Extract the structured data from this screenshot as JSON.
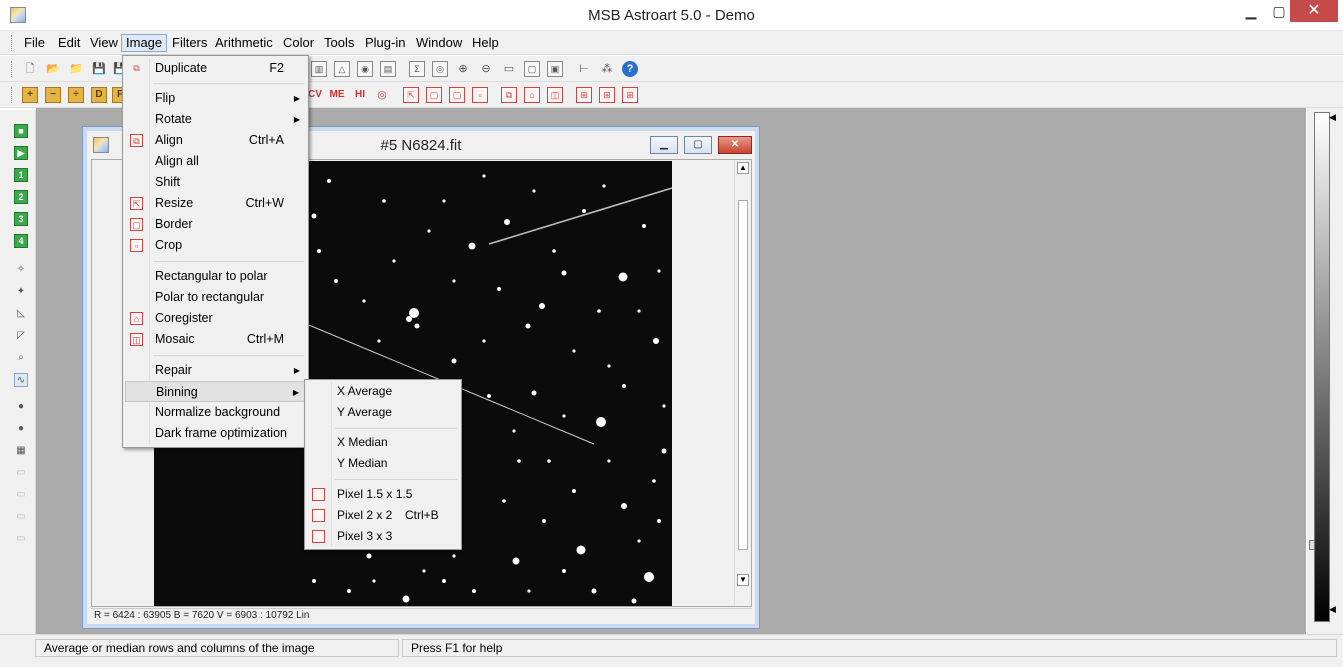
{
  "window": {
    "title": "MSB Astroart 5.0 - Demo",
    "min": "▁",
    "max": "▢",
    "close": "✕"
  },
  "menubar": [
    "File",
    "Edit",
    "View",
    "Image",
    "Filters",
    "Arithmetic",
    "Color",
    "Tools",
    "Plug-in",
    "Window",
    "Help"
  ],
  "toolbar2_text": [
    "CV",
    "ME",
    "HI"
  ],
  "child": {
    "title": "#5 N6824.fit",
    "status": "R = 6424 : 63905    B = 7620    V = 6903 : 10792 Lin"
  },
  "image_menu": {
    "items": [
      {
        "label": "Duplicate",
        "shortcut": "F2",
        "icon": "duplicate-icon"
      },
      {
        "label": "Flip",
        "submenu": "▶"
      },
      {
        "label": "Rotate",
        "submenu": "▶"
      },
      {
        "label": "Align",
        "shortcut": "Ctrl+A",
        "icon": "align-icon"
      },
      {
        "label": "Align all"
      },
      {
        "label": "Shift"
      },
      {
        "label": "Resize",
        "shortcut": "Ctrl+W",
        "icon": "resize-icon"
      },
      {
        "label": "Border",
        "icon": "border-icon"
      },
      {
        "label": "Crop",
        "icon": "crop-icon"
      },
      {
        "label": "Rectangular to polar"
      },
      {
        "label": "Polar to rectangular"
      },
      {
        "label": "Coregister",
        "icon": "coregister-icon"
      },
      {
        "label": "Mosaic",
        "shortcut": "Ctrl+M",
        "icon": "mosaic-icon"
      },
      {
        "label": "Repair",
        "submenu": "▶"
      },
      {
        "label": "Binning",
        "submenu": "▶",
        "highlighted": true
      },
      {
        "label": "Normalize background"
      },
      {
        "label": "Dark frame optimization"
      }
    ]
  },
  "binning_menu": {
    "items": [
      {
        "label": "X Average"
      },
      {
        "label": "Y Average"
      },
      {
        "label": "X Median"
      },
      {
        "label": "Y Median"
      },
      {
        "label": "Pixel 1.5 x 1.5",
        "icon": "pixel-grid-icon"
      },
      {
        "label": "Pixel 2 x 2",
        "shortcut": "Ctrl+B",
        "icon": "pixel-grid-icon"
      },
      {
        "label": "Pixel 3 x 3",
        "icon": "pixel-grid-icon"
      }
    ]
  },
  "statusbar": {
    "hint": "Average or median rows and columns of the image",
    "help": "Press F1 for help"
  },
  "colors": {
    "accent": "#dfe9f6",
    "close": "#c74a4a",
    "workspace": "#ababab"
  }
}
